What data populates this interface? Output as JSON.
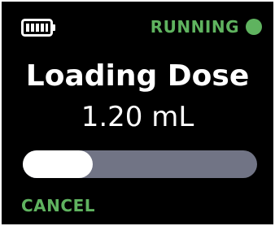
{
  "colors": {
    "accent": "#5fb35f",
    "track": "#717485",
    "fill": "#ffffff",
    "text": "#ffffff",
    "background": "#000000"
  },
  "status_bar": {
    "battery_icon": "battery-icon",
    "battery_level_fraction": 1.0,
    "status_label": "RUNNING",
    "status_indicator_icon": "status-dot-icon"
  },
  "main": {
    "title": "Loading Dose",
    "volume": "1.20 mL"
  },
  "progress": {
    "fraction": 0.3
  },
  "footer": {
    "cancel_label": "CANCEL"
  }
}
